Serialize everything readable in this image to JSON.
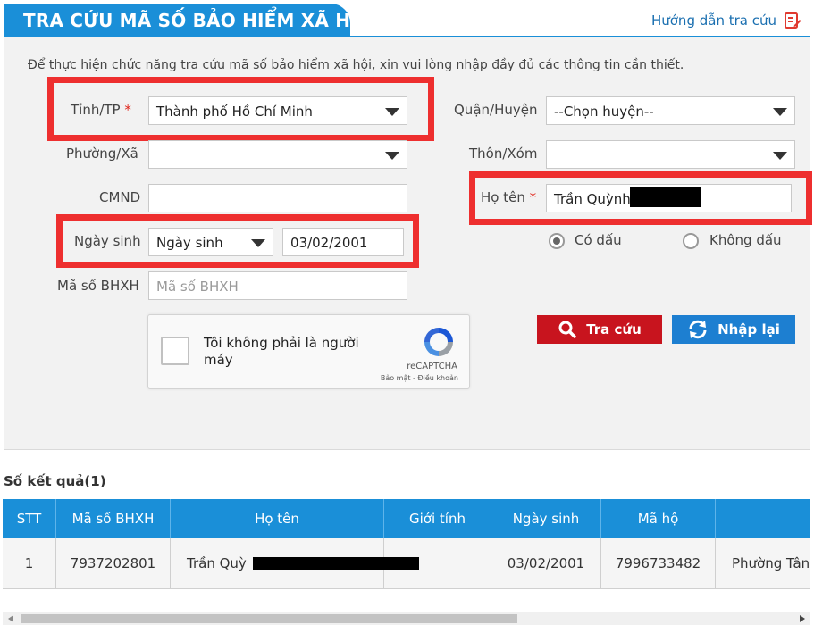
{
  "header": {
    "title": "TRA CỨU MÃ SỐ BẢO HIỂM XÃ HỘI",
    "guide_link": "Hướng dẫn tra cứu"
  },
  "form": {
    "intro": "Để thực hiện chức năng tra cứu mã số bảo hiểm xã hội, xin vui lòng nhập đầy đủ các thông tin cần thiết.",
    "province": {
      "label": "Tỉnh/TP",
      "required_mark": "*",
      "value": "Thành phố Hồ Chí Minh"
    },
    "district": {
      "label": "Quận/Huyện",
      "value": "--Chọn huyện--"
    },
    "ward": {
      "label": "Phường/Xã",
      "value": ""
    },
    "village": {
      "label": "Thôn/Xóm",
      "value": ""
    },
    "id_card": {
      "label": "CMND",
      "value": ""
    },
    "full_name": {
      "label": "Họ tên",
      "required_mark": "*",
      "value": "Trần Quỳnh"
    },
    "birth": {
      "label": "Ngày sinh",
      "type_value": "Ngày sinh",
      "date_value": "03/02/2001"
    },
    "bhxh": {
      "label": "Mã số BHXH",
      "placeholder": "Mã số BHXH"
    },
    "diacritics": {
      "option_with": "Có dấu",
      "option_without": "Không dấu",
      "selected": "Có dấu"
    },
    "buttons": {
      "search": "Tra cứu",
      "reset": "Nhập lại"
    },
    "captcha": {
      "text": "Tôi không phải là người máy",
      "brand": "reCAPTCHA",
      "links": "Bảo mật - Điều khoản"
    }
  },
  "results": {
    "title": "Số kết quả(1)",
    "columns": [
      "STT",
      "Mã số BHXH",
      "Họ tên",
      "Giới tính",
      "Ngày sinh",
      "Mã hộ",
      ""
    ],
    "rows": [
      {
        "stt": "1",
        "bhxh": "7937202801",
        "name": "Trần Quỳ",
        "gender": "",
        "birth": "03/02/2001",
        "household": "7996733482",
        "address": "Phường Tân"
      }
    ]
  },
  "colors": {
    "primary_blue": "#1a8fd8",
    "highlight_red": "#ee2f2f",
    "search_button": "#c8141e",
    "reset_button": "#1d7fd1"
  }
}
